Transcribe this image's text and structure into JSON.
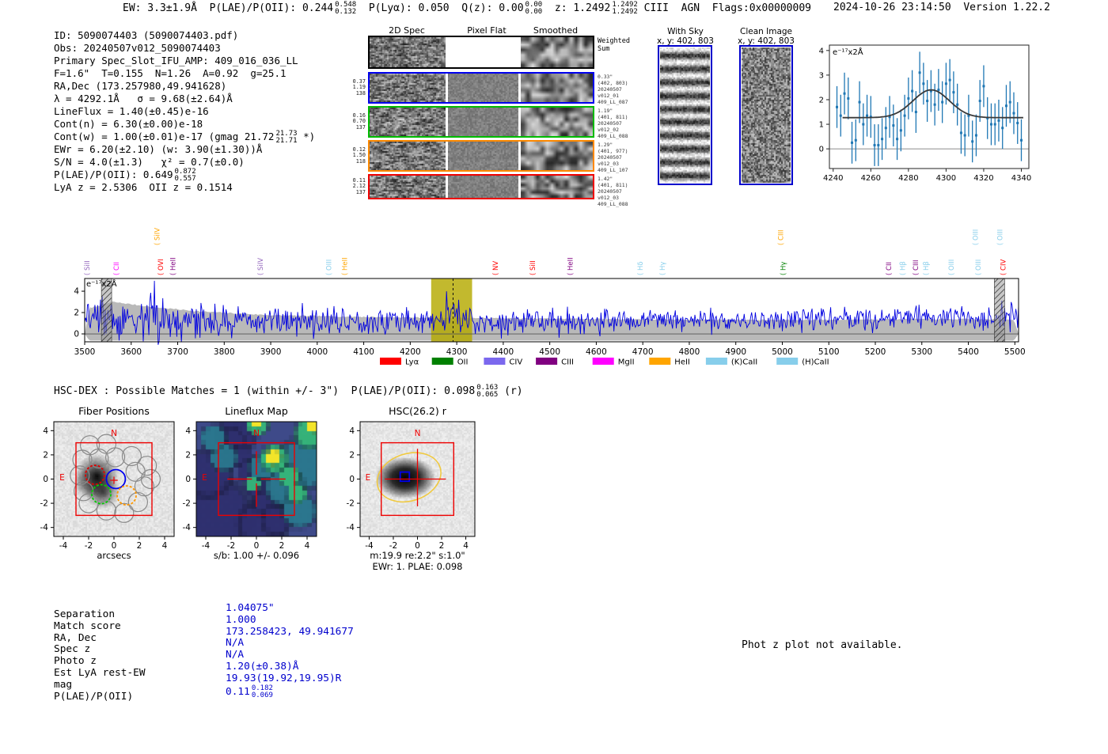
{
  "header": {
    "left": [
      {
        "t": "EW: 3.3±1.9Å  P(LAE)/P(OII): 0.244"
      },
      {
        "top": "0.548",
        "bot": "0.132"
      },
      {
        "t": "  P(Lyα): 0.050  Q(z): 0.00"
      },
      {
        "top": "0.00",
        "bot": "0.00"
      },
      {
        "t": "  z: 1.2492"
      },
      {
        "top": "1.2492",
        "bot": "1.2492"
      },
      {
        "t": " CIII  AGN  Flags:0x00000009"
      }
    ],
    "timestamp": "2024-10-26 23:14:50  Version 1.22.2"
  },
  "info_lines": [
    [
      {
        "t": "ID: 5090074403 (5090074403.pdf)"
      }
    ],
    [
      {
        "t": "Obs: 20240507v012_5090074403"
      }
    ],
    [
      {
        "t": "Primary Spec_Slot_IFU_AMP: 409_016_036_LL"
      }
    ],
    [
      {
        "t": "F=1.6\"  T=0.155  N=1.26  A=0.92  g=25.1"
      }
    ],
    [
      {
        "t": "RA,Dec (173.257980,49.941628)"
      }
    ],
    [
      {
        "t": "λ = 4292.1Å   σ = 9.68(±2.64)Å"
      }
    ],
    [
      {
        "t": "LineFlux = 1.40(±0.45)e-16"
      }
    ],
    [
      {
        "t": "Cont(n) = 6.30(±0.00)e-18"
      }
    ],
    [
      {
        "t": "Cont(w) = 1.00(±0.01)e-17 (gmag 21.72"
      },
      {
        "top": "21.73",
        "bot": "21.71"
      },
      {
        "t": " *)"
      }
    ],
    [
      {
        "t": "EWr = 6.20(±2.10) (w: 3.90(±1.30))Å"
      }
    ],
    [
      {
        "t": "S/N = 4.0(±1.3)   χ² = 0.7(±0.0)"
      }
    ],
    [
      {
        "t": "P(LAE)/P(OII): 0.649"
      },
      {
        "top": "0.872",
        "bot": "0.557"
      }
    ],
    [
      {
        "t": "LyA z = 2.5306  OII z = 0.1514"
      }
    ]
  ],
  "spec2d": {
    "col_titles": [
      "2D Spec",
      "Pixel Flat",
      "Smoothed"
    ],
    "rows": [
      {
        "border": "#000000",
        "left": [],
        "right": [
          "Weighted",
          "Sum"
        ],
        "big_right": true
      },
      {
        "border": "#0000ee",
        "left": [
          "0.37",
          "1.19",
          "138"
        ],
        "right": [
          "0.33\"",
          "(402, 803)",
          "20240507",
          "v012_01",
          "409_LL_087"
        ]
      },
      {
        "border": "#00bb00",
        "left": [
          "0.16",
          "0.70",
          "137"
        ],
        "right": [
          "1.19\"",
          "(401, 811)",
          "20240507",
          "v012_02",
          "409_LL_088"
        ]
      },
      {
        "border": "#ff8800",
        "left": [
          "0.12",
          "1.50",
          "118"
        ],
        "right": [
          "1.29\"",
          "(401, 977)",
          "20240507",
          "v012_03",
          "409_LL_107"
        ]
      },
      {
        "border": "#ee0000",
        "left": [
          "0.11",
          "2.12",
          "137"
        ],
        "right": [
          "1.42\"",
          "(401, 811)",
          "20240507",
          "v012_03",
          "409_LL_088"
        ]
      }
    ],
    "withsky": {
      "title": "With Sky",
      "subtitle": "x, y: 402, 803"
    },
    "clean": {
      "title": "Clean Image",
      "subtitle": "x, y: 402, 803"
    }
  },
  "hscdex": [
    {
      "t": "HSC-DEX : Possible Matches = 1 (within +/- 3\")  P(LAE)/P(OII): 0.098"
    },
    {
      "top": "0.163",
      "bot": "0.065"
    },
    {
      "t": " (r)"
    }
  ],
  "cutouts": {
    "fiber": {
      "title": "Fiber Positions",
      "xlabel": "arcsecs"
    },
    "lineflux": {
      "title": "Lineflux Map",
      "xlabel": "s/b: 1.00 +/- 0.096"
    },
    "hsc": {
      "title": "HSC(26.2) r",
      "xlabel1": "m:19.9  re:2.2\"  s:1.0\"",
      "xlabel2": "EWr: 1. PLAE: 0.098"
    }
  },
  "match_table": {
    "labels": [
      "Separation",
      "Match score",
      "RA, Dec",
      "Spec z",
      "Photo z",
      "Est LyA rest-EW",
      "mag",
      "P(LAE)/P(OII)"
    ],
    "values": [
      [
        {
          "t": "1.04075\""
        }
      ],
      [
        {
          "t": "1.000"
        }
      ],
      [
        {
          "t": "173.258423, 49.941677"
        }
      ],
      [
        {
          "t": "N/A"
        }
      ],
      [
        {
          "t": "N/A"
        }
      ],
      [
        {
          "t": "1.20(±0.38)Å"
        }
      ],
      [
        {
          "t": "19.93(19.92,19.95)R"
        }
      ],
      [
        {
          "t": "0.11"
        },
        {
          "top": "0.182",
          "bot": "0.069"
        }
      ]
    ],
    "value_color": "#0000cd"
  },
  "photz_note": "Phot z plot not available.",
  "chart_data": [
    {
      "type": "scatter",
      "name": "zoomed_line_fit",
      "annotation": "e⁻¹⁷x2Å",
      "x_start": 4242,
      "x_step": 2,
      "y": [
        1.7,
        1.35,
        2.25,
        2.05,
        0.25,
        0.35,
        1.9,
        1.0,
        1.35,
        1.3,
        0.15,
        0.15,
        0.4,
        0.85,
        1.3,
        0.95,
        0.4,
        0.75,
        1.35,
        2.05,
        2.35,
        1.5,
        3.1,
        2.65,
        1.95,
        2.35,
        1.8,
        2.4,
        1.9,
        2.65,
        2.8,
        2.3,
        1.8,
        0.65,
        0.55,
        1.35,
        0.3,
        0.55,
        1.95,
        2.55,
        1.25,
        1.0,
        1.0,
        1.15,
        0.85,
        1.75,
        1.9,
        1.45,
        1.05,
        0.35
      ],
      "yerr": 0.85,
      "fit": {
        "baseline": 1.27,
        "amplitude": 1.13,
        "center": 4292.1,
        "sigma": 9.68
      },
      "xticks": [
        4240,
        4260,
        4280,
        4300,
        4320,
        4340
      ],
      "yticks": [
        0,
        1,
        2,
        3,
        4
      ],
      "xlim": [
        4238,
        4344
      ],
      "ylim": [
        -0.8,
        4.22
      ],
      "point_color": "#1f77b4",
      "fit_color": "#3a3a3a"
    },
    {
      "type": "line",
      "name": "full_spectrum",
      "annotation": "e⁻¹⁷x2Å",
      "xlim": [
        3500,
        5508
      ],
      "ylim": [
        -0.74,
        5.19
      ],
      "xticks_start": 3500,
      "xticks_step": 100,
      "xticks_n": 21,
      "yticks": [
        0,
        2,
        4
      ],
      "line_color": "#0000e0",
      "err_fill": "#b5b5b5",
      "highlight": {
        "from": 4245,
        "to": 4333,
        "color": "#b5a900",
        "center": 4292.1
      },
      "masked": [
        [
          3536,
          3558
        ],
        [
          5456,
          5478
        ]
      ],
      "noise_profile": {
        "wl": [
          3500,
          3560,
          3650,
          3750,
          3900,
          4100,
          4300,
          4600,
          5000,
          5300,
          5500
        ],
        "mean": [
          1.5,
          1.55,
          1.4,
          1.3,
          1.25,
          1.2,
          1.2,
          1.2,
          1.25,
          1.45,
          1.5
        ],
        "amp": [
          1.35,
          1.6,
          1.45,
          1.15,
          1.0,
          0.95,
          0.9,
          0.85,
          0.8,
          0.85,
          0.9
        ],
        "err_top": [
          2.3,
          3.0,
          2.5,
          2.1,
          1.75,
          1.6,
          1.5,
          1.4,
          1.3,
          1.4,
          1.35
        ],
        "err_bot": -0.62,
        "seed": 7
      },
      "line_labels": [
        [
          "SiII",
          3505,
          "#9467bd",
          0
        ],
        [
          "CII",
          3568,
          "#ff00ff",
          0
        ],
        [
          "SiIV",
          3656,
          "#FFA500",
          1
        ],
        [
          "OVI",
          3663,
          "#ff0000",
          0
        ],
        [
          "HeII",
          3690,
          "#800080",
          0
        ],
        [
          "SiIV",
          3878,
          "#9467bd",
          0
        ],
        [
          "OIII",
          4025,
          "#87CEEB",
          0
        ],
        [
          "HeII",
          4059,
          "#FFA500",
          0
        ],
        [
          "NV",
          4383,
          "#ff0000",
          0
        ],
        [
          "SiII",
          4463,
          "#ff0000",
          0
        ],
        [
          "HeII",
          4544,
          "#800080",
          0
        ],
        [
          "Hδ",
          4695,
          "#87CEEB",
          0
        ],
        [
          "Hγ",
          4742,
          "#87CEEB",
          0
        ],
        [
          "CIII",
          4997,
          "#FFA500",
          1
        ],
        [
          "Hγ",
          5002,
          "#008000",
          0
        ],
        [
          "CII",
          5229,
          "#800080",
          0
        ],
        [
          "Hβ",
          5259,
          "#87CEEB",
          0
        ],
        [
          "CIII",
          5287,
          "#800080",
          0
        ],
        [
          "Hβ",
          5309,
          "#87CEEB",
          0
        ],
        [
          "OIII",
          5363,
          "#87CEEB",
          0
        ],
        [
          "OIII",
          5415,
          "#87CEEB",
          1
        ],
        [
          "OIII",
          5421,
          "#87CEEB",
          0
        ],
        [
          "OIII",
          5468,
          "#87CEEB",
          1
        ],
        [
          "CIV",
          5475,
          "#ff0000",
          0
        ]
      ],
      "legend": [
        [
          "Lyα",
          "#ff0000"
        ],
        [
          "OII",
          "#008000"
        ],
        [
          "CIV",
          "#7B68EE"
        ],
        [
          "CIII",
          "#800080"
        ],
        [
          "MgII",
          "#ff00ff"
        ],
        [
          "HeII",
          "#FFA500"
        ],
        [
          "(K)CaII",
          "#87CEEB"
        ],
        [
          "(H)CaII",
          "#87CEEB"
        ]
      ]
    },
    {
      "type": "map",
      "name": "fiber_positions",
      "ticks": [
        -4,
        -2,
        0,
        2,
        4
      ],
      "box_half": 3,
      "fiber_radius": 0.75,
      "gray_fibers": [
        [
          -1.9,
          2.8
        ],
        [
          -0.6,
          2.9
        ],
        [
          -2.5,
          1.6
        ],
        [
          -1.2,
          1.7
        ],
        [
          0.1,
          1.8
        ],
        [
          1.4,
          1.9
        ],
        [
          2.6,
          1.1
        ],
        [
          -2.7,
          0.3
        ],
        [
          1.7,
          0.6
        ],
        [
          2.9,
          0.0
        ],
        [
          -2.4,
          -1.0
        ],
        [
          2.4,
          -0.6
        ],
        [
          -2.0,
          -2.0
        ],
        [
          1.9,
          -1.9
        ],
        [
          -0.6,
          -2.6
        ],
        [
          0.8,
          -2.8
        ]
      ],
      "colored_fibers": [
        {
          "x": -1.5,
          "y": 0.35,
          "c": "#dd0000",
          "dash": true
        },
        {
          "x": 0.15,
          "y": 0.0,
          "c": "#0000ee",
          "dash": false
        },
        {
          "x": -1.0,
          "y": -1.25,
          "c": "#00cc00",
          "dash": true
        },
        {
          "x": 1.0,
          "y": -1.35,
          "c": "#ff9900",
          "dash": true
        }
      ],
      "compass": {
        "n": "N",
        "e": "E",
        "color": "#ee0000"
      }
    },
    {
      "type": "heatmap",
      "name": "lineflux_map",
      "ticks": [
        -4,
        -2,
        0,
        2,
        4
      ],
      "box_half": 3,
      "base": "#3E4A89",
      "blobs": [
        {
          "x": -3.2,
          "y": -3.0,
          "r": 3.4,
          "c": "#2E2F6E"
        },
        {
          "x": -3.8,
          "y": 0.5,
          "r": 2.2,
          "c": "#2E2F6E"
        },
        {
          "x": -1.5,
          "y": 3.8,
          "r": 1.8,
          "c": "#2E2F6E"
        },
        {
          "x": 0.5,
          "y": -3.8,
          "r": 2.2,
          "c": "#2E2F6E"
        },
        {
          "x": -2.0,
          "y": 3.2,
          "r": 1.2,
          "c": "#2E2F6E"
        },
        {
          "x": -1.2,
          "y": 1.8,
          "r": 1.1,
          "c": "#2E2F6E"
        },
        {
          "x": -0.6,
          "y": 0.6,
          "r": 1.0,
          "c": "#2E2F6E"
        },
        {
          "x": 0.0,
          "y": -0.6,
          "r": 1.0,
          "c": "#2E2F6E"
        },
        {
          "x": 0.8,
          "y": -2.0,
          "r": 1.2,
          "c": "#2E2F6E"
        },
        {
          "x": 1.6,
          "y": -3.4,
          "r": 1.4,
          "c": "#2E2F6E"
        },
        {
          "x": 3.6,
          "y": 1.2,
          "r": 2.4,
          "c": "#2A788E"
        },
        {
          "x": 2.2,
          "y": -0.6,
          "r": 1.8,
          "c": "#2A788E"
        },
        {
          "x": -2.6,
          "y": 1.8,
          "r": 1.3,
          "c": "#2A788E"
        },
        {
          "x": -3.4,
          "y": 3.4,
          "r": 1.2,
          "c": "#2A788E"
        },
        {
          "x": 3.4,
          "y": -2.6,
          "r": 1.6,
          "c": "#2A788E"
        },
        {
          "x": 0.4,
          "y": 1.0,
          "r": 1.2,
          "c": "#2A788E"
        },
        {
          "x": 1.4,
          "y": 1.7,
          "r": 1.3,
          "c": "#35B779"
        },
        {
          "x": 4.2,
          "y": 3.8,
          "r": 1.4,
          "c": "#35B779"
        },
        {
          "x": 0.1,
          "y": 4.5,
          "r": 1.0,
          "c": "#35B779"
        },
        {
          "x": 2.6,
          "y": 0.2,
          "r": 1.0,
          "c": "#35B779"
        },
        {
          "x": -0.3,
          "y": -0.4,
          "r": 0.7,
          "c": "#35B779"
        },
        {
          "x": 3.2,
          "y": -1.2,
          "r": 0.9,
          "c": "#35B779"
        },
        {
          "x": 1.35,
          "y": 1.8,
          "r": 0.75,
          "c": "#FDE725"
        },
        {
          "x": 0.05,
          "y": 4.65,
          "r": 0.5,
          "c": "#FDE725"
        },
        {
          "x": 4.5,
          "y": 4.3,
          "r": 0.55,
          "c": "#FDE725"
        }
      ],
      "compass": {
        "n": "N",
        "e": "E",
        "color": "#ee0000"
      }
    },
    {
      "type": "map",
      "name": "hsc_cutout",
      "ticks": [
        -4,
        -2,
        0,
        2,
        4
      ],
      "box_half": 3,
      "ellipse": {
        "cx": -0.7,
        "cy": 0.15,
        "rx": 2.7,
        "ry": 1.95,
        "rot": -18,
        "c": "#f0c93f"
      },
      "blue_box": {
        "x": -1.05,
        "y": 0.2,
        "half": 0.38,
        "c": "#0000ee"
      },
      "compass": {
        "n": "N",
        "e": "E",
        "color": "#ee0000"
      }
    }
  ]
}
